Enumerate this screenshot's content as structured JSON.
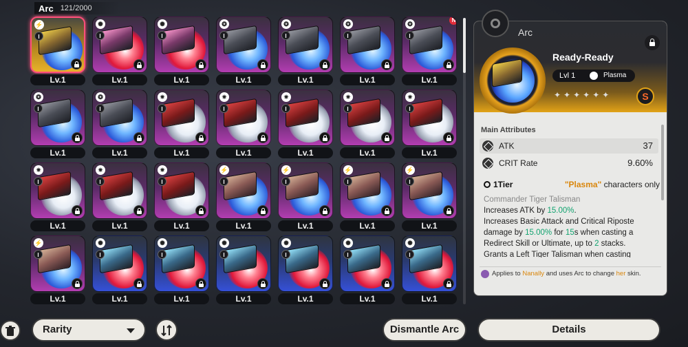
{
  "inventory": {
    "title": "Arc",
    "count": "121/2000"
  },
  "cards": [
    {
      "tile": "gold",
      "disc": "d-blue",
      "art": "art-yellow",
      "attr": "⚡",
      "tier": "I",
      "lvl": "Lv.1",
      "selected": true,
      "new": false
    },
    {
      "tile": "pink",
      "disc": "d-red",
      "art": "art-pink",
      "attr": "✺",
      "tier": "I",
      "lvl": "Lv.1",
      "selected": false,
      "new": false
    },
    {
      "tile": "pink",
      "disc": "d-red",
      "art": "art-pink",
      "attr": "✺",
      "tier": "I",
      "lvl": "Lv.1",
      "selected": false,
      "new": false
    },
    {
      "tile": "pink",
      "disc": "d-blue",
      "art": "",
      "attr": "❂",
      "tier": "I",
      "lvl": "Lv.1",
      "selected": false,
      "new": false
    },
    {
      "tile": "pink",
      "disc": "d-blue",
      "art": "",
      "attr": "❂",
      "tier": "I",
      "lvl": "Lv.1",
      "selected": false,
      "new": false
    },
    {
      "tile": "pink",
      "disc": "d-blue",
      "art": "",
      "attr": "❂",
      "tier": "I",
      "lvl": "Lv.1",
      "selected": false,
      "new": false
    },
    {
      "tile": "pink",
      "disc": "d-blue",
      "art": "",
      "attr": "❂",
      "tier": "I",
      "lvl": "Lv.1",
      "selected": false,
      "new": true
    },
    {
      "tile": "pink",
      "disc": "d-blue",
      "art": "",
      "attr": "❂",
      "tier": "I",
      "lvl": "Lv.1",
      "selected": false,
      "new": false
    },
    {
      "tile": "pink",
      "disc": "d-blue",
      "art": "",
      "attr": "❂",
      "tier": "I",
      "lvl": "Lv.1",
      "selected": false,
      "new": false
    },
    {
      "tile": "pink",
      "disc": "d-white",
      "art": "art-red",
      "attr": "✷",
      "tier": "I",
      "lvl": "Lv.1",
      "selected": false,
      "new": false
    },
    {
      "tile": "pink",
      "disc": "d-white",
      "art": "art-red",
      "attr": "✷",
      "tier": "I",
      "lvl": "Lv.1",
      "selected": false,
      "new": false
    },
    {
      "tile": "pink",
      "disc": "d-white",
      "art": "art-red",
      "attr": "✷",
      "tier": "I",
      "lvl": "Lv.1",
      "selected": false,
      "new": false
    },
    {
      "tile": "pink",
      "disc": "d-white",
      "art": "art-red",
      "attr": "✷",
      "tier": "I",
      "lvl": "Lv.1",
      "selected": false,
      "new": false
    },
    {
      "tile": "pink",
      "disc": "d-white",
      "art": "art-red",
      "attr": "✷",
      "tier": "I",
      "lvl": "Lv.1",
      "selected": false,
      "new": false
    },
    {
      "tile": "pink",
      "disc": "d-white",
      "art": "art-red",
      "attr": "✷",
      "tier": "I",
      "lvl": "Lv.1",
      "selected": false,
      "new": false
    },
    {
      "tile": "pink",
      "disc": "d-white",
      "art": "art-red",
      "attr": "✷",
      "tier": "I",
      "lvl": "Lv.1",
      "selected": false,
      "new": false
    },
    {
      "tile": "pink",
      "disc": "d-white",
      "art": "art-red",
      "attr": "✷",
      "tier": "I",
      "lvl": "Lv.1",
      "selected": false,
      "new": false
    },
    {
      "tile": "pink",
      "disc": "d-blue",
      "art": "art-photo",
      "attr": "⚡",
      "tier": "I",
      "lvl": "Lv.1",
      "selected": false,
      "new": false
    },
    {
      "tile": "pink",
      "disc": "d-blue",
      "art": "art-photo",
      "attr": "⚡",
      "tier": "I",
      "lvl": "Lv.1",
      "selected": false,
      "new": false
    },
    {
      "tile": "pink",
      "disc": "d-blue",
      "art": "art-photo",
      "attr": "⚡",
      "tier": "I",
      "lvl": "Lv.1",
      "selected": false,
      "new": false
    },
    {
      "tile": "pink",
      "disc": "d-blue",
      "art": "art-photo",
      "attr": "⚡",
      "tier": "I",
      "lvl": "Lv.1",
      "selected": false,
      "new": false
    },
    {
      "tile": "pink",
      "disc": "d-blue",
      "art": "art-photo",
      "attr": "⚡",
      "tier": "I",
      "lvl": "Lv.1",
      "selected": false,
      "new": false
    },
    {
      "tile": "blue",
      "disc": "d-red",
      "art": "art-cyan",
      "attr": "✺",
      "tier": "I",
      "lvl": "Lv.1",
      "selected": false,
      "new": false
    },
    {
      "tile": "blue",
      "disc": "d-red",
      "art": "art-cyan",
      "attr": "✺",
      "tier": "I",
      "lvl": "Lv.1",
      "selected": false,
      "new": false
    },
    {
      "tile": "blue",
      "disc": "d-red",
      "art": "art-cyan",
      "attr": "✺",
      "tier": "I",
      "lvl": "Lv.1",
      "selected": false,
      "new": false
    },
    {
      "tile": "blue",
      "disc": "d-red",
      "art": "art-cyan",
      "attr": "✺",
      "tier": "I",
      "lvl": "Lv.1",
      "selected": false,
      "new": false
    },
    {
      "tile": "blue",
      "disc": "d-red",
      "art": "art-cyan",
      "attr": "✺",
      "tier": "I",
      "lvl": "Lv.1",
      "selected": false,
      "new": false
    },
    {
      "tile": "blue",
      "disc": "d-red",
      "art": "art-cyan",
      "attr": "✺",
      "tier": "I",
      "lvl": "Lv.1",
      "selected": false,
      "new": false
    }
  ],
  "toolbar": {
    "delete_icon": "trash-icon",
    "rarity_label": "Rarity",
    "sort_icon": "sort-order-icon",
    "dismantle_label": "Dismantle Arc",
    "details_label": "Details"
  },
  "detail": {
    "category": "Arc",
    "name": "Ready-Ready",
    "level": "Lvl 1",
    "element": "Plasma",
    "stars": "✦✦✦✦✦✦",
    "rank_glyph": "S",
    "main_attributes_title": "Main Attributes",
    "stats": [
      {
        "name": "ATK",
        "value": "37"
      },
      {
        "name": "CRIT Rate",
        "value": "9.60%"
      }
    ],
    "tier_label": "1Tier",
    "req_element": "\"Plasma\"",
    "req_text": "characters only",
    "skill_name": "Commander Tiger Talisman",
    "skill_line1_a": "Increases ATK by ",
    "skill_line1_b": "15.00%",
    "skill_line1_c": ".",
    "skill_line2_a": "Increases Basic Attack and Critical Riposte damage by ",
    "skill_line2_b": "15.00%",
    "skill_line2_c": " for ",
    "skill_line2_d": "15",
    "skill_line2_e": "s when casting a Redirect Skill or Ultimate, up to ",
    "skill_line2_f": "2",
    "skill_line2_g": " stacks.",
    "skill_line3": "Grants a Left Tiger Talisman when casting Redirect Skill and a Right Tiger Talisman",
    "skin_a": "Applies to ",
    "skin_b": "Nanally",
    "skin_c": " and uses Arc to change ",
    "skin_d": "her",
    "skin_e": " skin."
  }
}
